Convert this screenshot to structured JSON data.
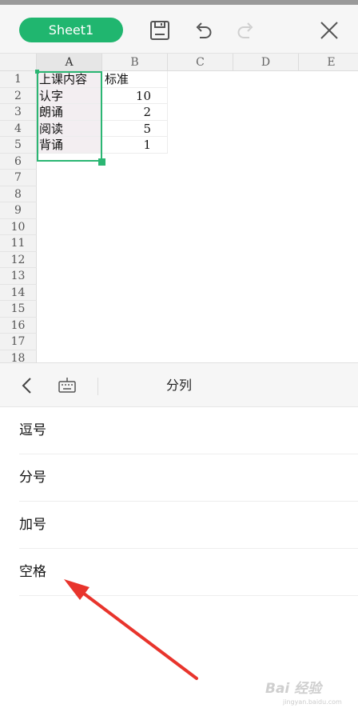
{
  "toolbar": {
    "sheet_tab": "Sheet1",
    "accent": "#20b66f"
  },
  "grid": {
    "columns": [
      "A",
      "B",
      "C",
      "D",
      "E"
    ],
    "rows": [
      "1",
      "2",
      "3",
      "4",
      "5",
      "6",
      "7",
      "8",
      "9",
      "10",
      "11",
      "12",
      "13",
      "14",
      "15",
      "16",
      "17",
      "18"
    ],
    "cells": [
      {
        "a": "上课内容",
        "b": "标准"
      },
      {
        "a": "认字",
        "b": "10"
      },
      {
        "a": "朗诵",
        "b": "2"
      },
      {
        "a": "阅读",
        "b": "5"
      },
      {
        "a": "背诵",
        "b": "1"
      }
    ],
    "selection_color": "#2bb673"
  },
  "panel": {
    "title": "分列",
    "options": [
      "逗号",
      "分号",
      "加号",
      "空格"
    ]
  },
  "annotation": {
    "arrow_color": "#e8342c"
  },
  "watermark": {
    "text": "Bai 经验",
    "sub": "jingyan.baidu.com"
  }
}
